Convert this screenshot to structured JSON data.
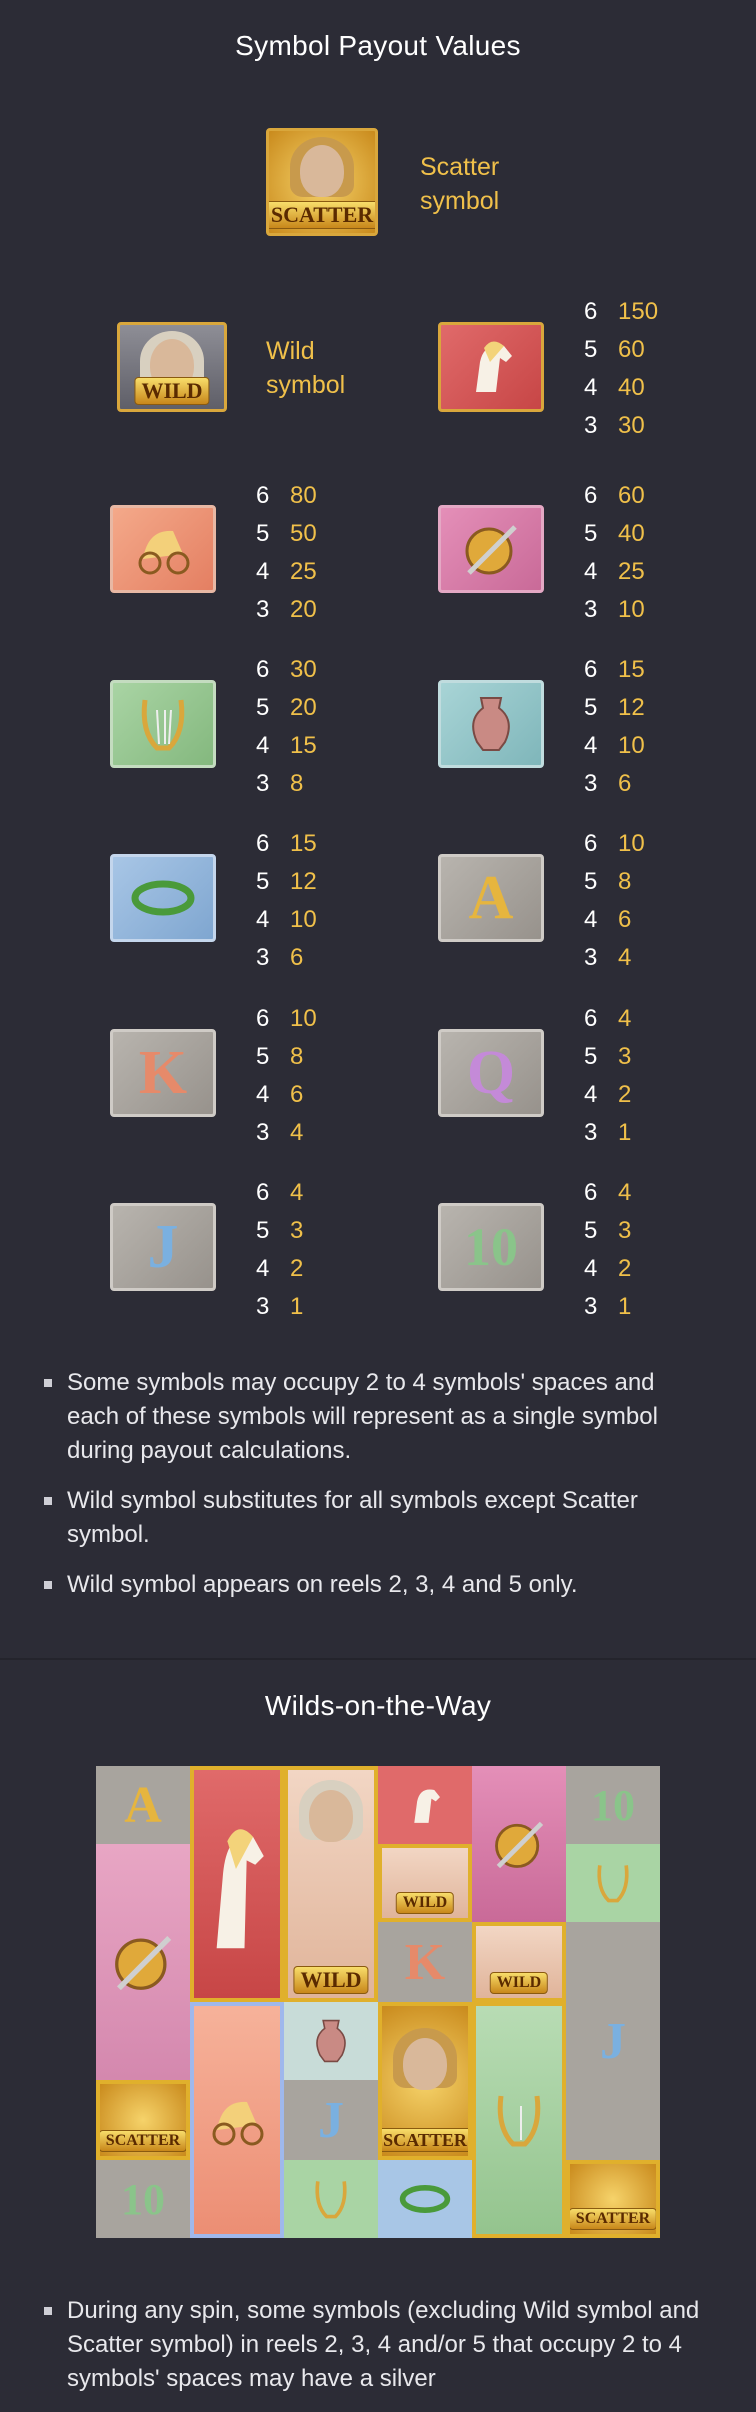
{
  "payout": {
    "title": "Symbol Payout Values",
    "scatter_label_1": "Scatter",
    "scatter_label_2": "symbol",
    "wild_label_1": "Wild",
    "wild_label_2": "symbol",
    "scatter_badge": "SCATTER",
    "wild_badge": "WILD",
    "symbols": [
      {
        "name": "horse",
        "pays": [
          [
            "6",
            "150"
          ],
          [
            "5",
            "60"
          ],
          [
            "4",
            "40"
          ],
          [
            "3",
            "30"
          ]
        ]
      },
      {
        "name": "chariot",
        "pays": [
          [
            "6",
            "80"
          ],
          [
            "5",
            "50"
          ],
          [
            "4",
            "25"
          ],
          [
            "3",
            "20"
          ]
        ]
      },
      {
        "name": "shield",
        "pays": [
          [
            "6",
            "60"
          ],
          [
            "5",
            "40"
          ],
          [
            "4",
            "25"
          ],
          [
            "3",
            "10"
          ]
        ]
      },
      {
        "name": "lyre",
        "pays": [
          [
            "6",
            "30"
          ],
          [
            "5",
            "20"
          ],
          [
            "4",
            "15"
          ],
          [
            "3",
            "8"
          ]
        ]
      },
      {
        "name": "vase",
        "pays": [
          [
            "6",
            "15"
          ],
          [
            "5",
            "12"
          ],
          [
            "4",
            "10"
          ],
          [
            "3",
            "6"
          ]
        ]
      },
      {
        "name": "laurel",
        "pays": [
          [
            "6",
            "15"
          ],
          [
            "5",
            "12"
          ],
          [
            "4",
            "10"
          ],
          [
            "3",
            "6"
          ]
        ]
      },
      {
        "name": "A",
        "glyph": "A",
        "pays": [
          [
            "6",
            "10"
          ],
          [
            "5",
            "8"
          ],
          [
            "4",
            "6"
          ],
          [
            "3",
            "4"
          ]
        ]
      },
      {
        "name": "K",
        "glyph": "K",
        "pays": [
          [
            "6",
            "10"
          ],
          [
            "5",
            "8"
          ],
          [
            "4",
            "6"
          ],
          [
            "3",
            "4"
          ]
        ]
      },
      {
        "name": "Q",
        "glyph": "Q",
        "pays": [
          [
            "6",
            "4"
          ],
          [
            "5",
            "3"
          ],
          [
            "4",
            "2"
          ],
          [
            "3",
            "1"
          ]
        ]
      },
      {
        "name": "J",
        "glyph": "J",
        "pays": [
          [
            "6",
            "4"
          ],
          [
            "5",
            "3"
          ],
          [
            "4",
            "2"
          ],
          [
            "3",
            "1"
          ]
        ]
      },
      {
        "name": "10",
        "glyph": "10",
        "pays": [
          [
            "6",
            "4"
          ],
          [
            "5",
            "3"
          ],
          [
            "4",
            "2"
          ],
          [
            "3",
            "1"
          ]
        ]
      }
    ]
  },
  "rules": [
    "Some symbols may occupy 2 to 4 symbols' spaces and each of these symbols will represent as a single symbol during payout calculations.",
    "Wild symbol substitutes for all symbols except Scatter symbol.",
    "Wild symbol appears on reels 2, 3, 4 and 5 only."
  ],
  "wilds": {
    "title": "Wilds-on-the-Way",
    "wild_badge": "WILD",
    "scatter_badge": "SCATTER",
    "glyph_a": "A",
    "glyph_k": "K",
    "glyph_j": "J",
    "glyph_10": "10"
  },
  "bottom_rule": "During any spin, some symbols (excluding Wild symbol and Scatter symbol) in reels 2, 3, 4 and/or 5 that occupy 2 to 4 symbols' spaces may have a silver",
  "colors": {
    "background": "#2c2c36",
    "accent_gold": "#f0c04a"
  }
}
